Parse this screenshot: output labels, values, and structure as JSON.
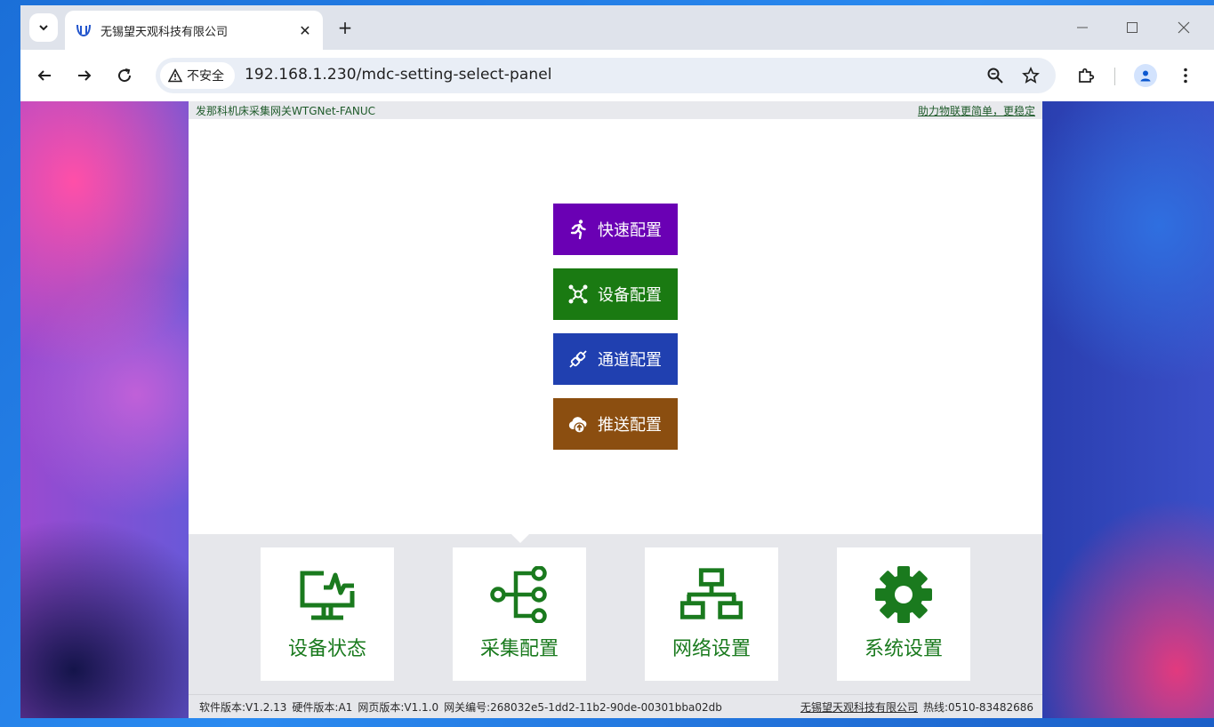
{
  "browser": {
    "tab_title": "无锡望天观科技有限公司",
    "security_label": "不安全",
    "url": "192.168.1.230/mdc-setting-select-panel"
  },
  "page": {
    "top_left": "发那科机床采集网关WTGNet-FANUC",
    "top_right": "助力物联更简单，更稳定",
    "quick_buttons": [
      {
        "label": "快速配置",
        "icon": "running-person-icon",
        "color": "#6a00b4"
      },
      {
        "label": "设备配置",
        "icon": "network-nodes-icon",
        "color": "#1a7a12"
      },
      {
        "label": "通道配置",
        "icon": "plug-connector-icon",
        "color": "#2040b0"
      },
      {
        "label": "推送配置",
        "icon": "cloud-upload-icon",
        "color": "#8b4e10"
      }
    ],
    "tiles": [
      {
        "label": "设备状态",
        "icon": "monitor-pulse-icon"
      },
      {
        "label": "采集配置",
        "icon": "branch-nodes-icon"
      },
      {
        "label": "网络设置",
        "icon": "lan-network-icon"
      },
      {
        "label": "系统设置",
        "icon": "gear-icon"
      }
    ],
    "tile_color": "#1a7a1e",
    "footer": {
      "software_version": "软件版本:V1.2.13",
      "hardware_version": "硬件版本:A1",
      "web_version": "网页版本:V1.1.0",
      "gateway_id": "网关编号:268032e5-1dd2-11b2-90de-00301bba02db",
      "company": "无锡望天观科技有限公司",
      "hotline": "热线:0510-83482686"
    }
  }
}
